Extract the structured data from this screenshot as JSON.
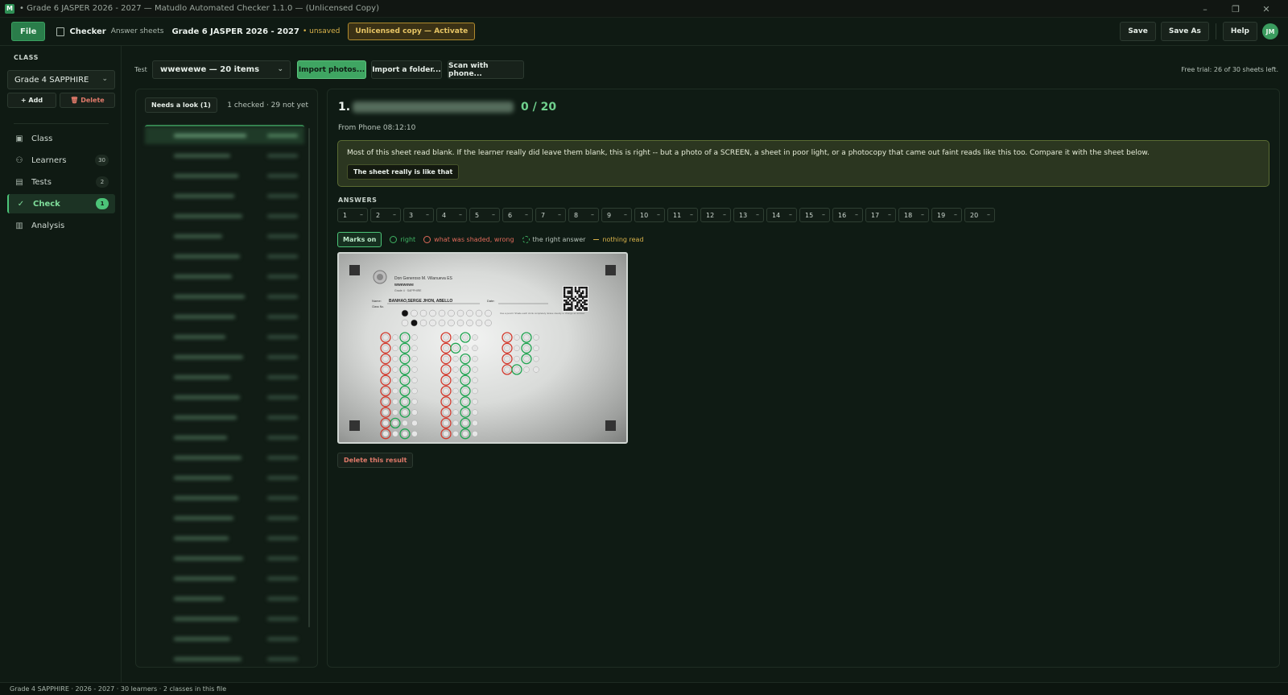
{
  "window": {
    "title": "• Grade 6 JASPER 2026 - 2027  —  Matudlo Automated Checker 1.1.0  —  (Unlicensed Copy)",
    "controls": [
      "–",
      "❐",
      "✕"
    ]
  },
  "toolbar": {
    "file_label": "File",
    "checker_label": "Checker",
    "checker_sub": "Answer sheets",
    "file_name": "Grade 6 JASPER 2026 - 2027",
    "unsaved": "• unsaved",
    "license_label": "Unlicensed copy — Activate",
    "save_label": "Save",
    "save_as_label": "Save As",
    "help_label": "Help",
    "avatar_initials": "JM"
  },
  "sidebar": {
    "section_label": "CLASS",
    "class_selected": "Grade 4 SAPPHIRE",
    "add_label": "+ Add",
    "delete_label": "🗑 Delete",
    "items": [
      {
        "label": "Class",
        "icon": "class-icon",
        "count": ""
      },
      {
        "label": "Learners",
        "icon": "learners-icon",
        "count": "30"
      },
      {
        "label": "Tests",
        "icon": "tests-icon",
        "count": "2"
      },
      {
        "label": "Check",
        "icon": "check-icon",
        "count": "1",
        "active": true
      },
      {
        "label": "Analysis",
        "icon": "analysis-icon",
        "count": ""
      }
    ]
  },
  "content": {
    "test_label": "Test",
    "test_selected": "wwewewe — 20 items",
    "import_photos": "Import photos...",
    "import_folder": "Import a folder...",
    "scan_phone": "Scan with phone...",
    "trial": "Free trial: 26 of 30 sheets left."
  },
  "list": {
    "needs_look": "Needs a look (1)",
    "count": "1 checked · 29 not yet"
  },
  "detail": {
    "number": "1.",
    "score": "0 / 20",
    "from": "From Phone 08:12:10",
    "warning": "Most of this sheet read blank. If the learner really did leave them blank, this is right -- but a photo of a SCREEN, a sheet in poor light, or a photocopy that came out faint reads like this too. Compare it with the sheet below.",
    "warning_button": "The sheet really is like that",
    "answers_label": "ANSWERS",
    "answers": [
      "1",
      "2",
      "3",
      "4",
      "5",
      "6",
      "7",
      "8",
      "9",
      "10",
      "11",
      "12",
      "13",
      "14",
      "15",
      "16",
      "17",
      "18",
      "19",
      "20"
    ],
    "answer_value": "–",
    "marks_on": "Marks on",
    "legend_right": "right",
    "legend_wrong": "what was shaded, wrong",
    "legend_key": "the right answer",
    "legend_none": "nothing read",
    "delete_result": "Delete this result"
  },
  "scan": {
    "school": "Don Generoso M. Villanueva ES",
    "test_name": "wwewewe",
    "grade": "Grade 4 · SAPPHIRE",
    "name_label": "Name:",
    "name_value": "BANHAO,SERGE JHON, ABELLO",
    "date_label": "Date:",
    "class_no_label": "Class No.",
    "instructions": "Use a pencil. Shade each circle completely. Erase cleanly to change an answer."
  },
  "statusbar": {
    "text": "Grade 4 SAPPHIRE · 2026 - 2027 · 30 learners · 2 classes in this file"
  },
  "colors": {
    "accent": "#3fa562",
    "right": "#3fb464",
    "wrong": "#e06a5a",
    "warning": "#d9b24a"
  }
}
